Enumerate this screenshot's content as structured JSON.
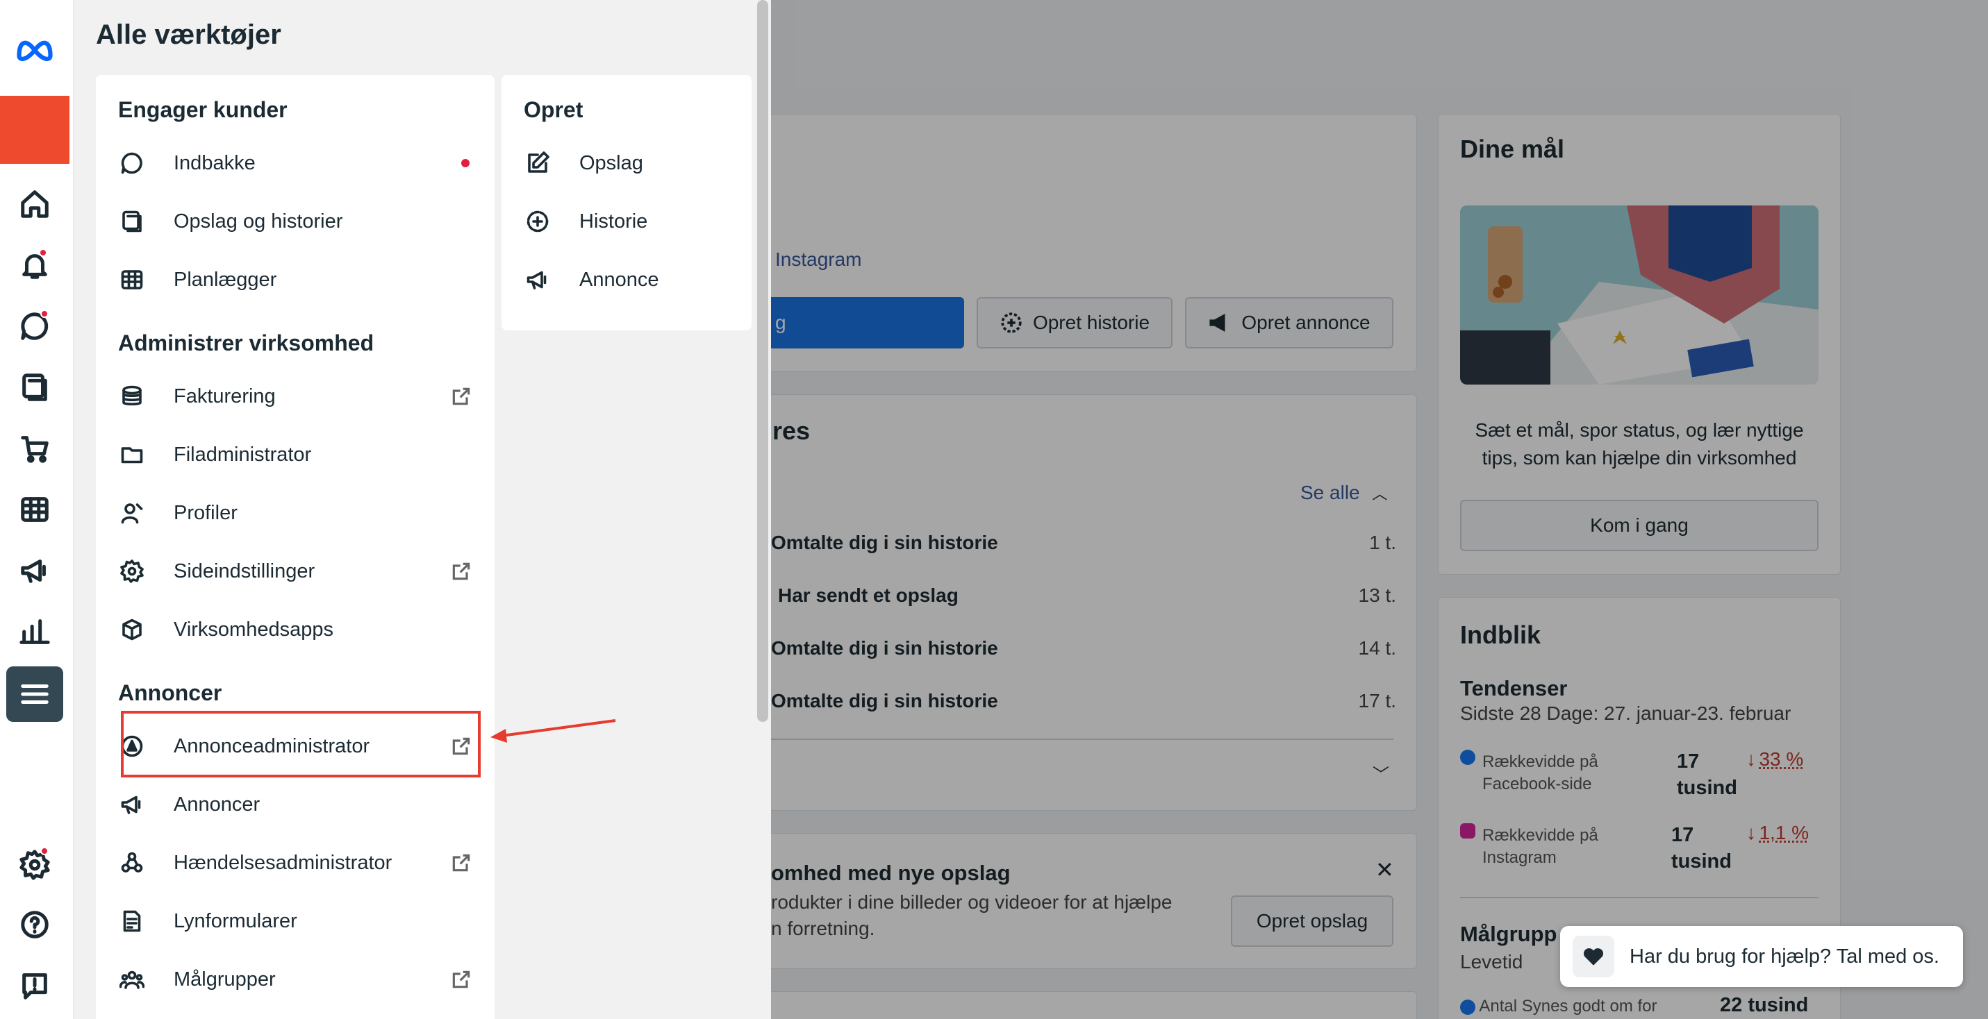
{
  "drawer": {
    "title": "Alle værktøjer",
    "engage": {
      "title": "Engager kunder",
      "items": [
        {
          "label": "Indbakke"
        },
        {
          "label": "Opslag og historier"
        },
        {
          "label": "Planlægger"
        }
      ]
    },
    "manage": {
      "title": "Administrer virksomhed",
      "items": [
        {
          "label": "Fakturering"
        },
        {
          "label": "Filadministrator"
        },
        {
          "label": "Profiler"
        },
        {
          "label": "Sideindstillinger"
        },
        {
          "label": "Virksomhedsapps"
        }
      ]
    },
    "ads": {
      "title": "Annoncer",
      "items": [
        {
          "label": "Annonceadministrator"
        },
        {
          "label": "Annoncer"
        },
        {
          "label": "Hændelsesadministrator"
        },
        {
          "label": "Lynformularer"
        },
        {
          "label": "Målgrupper"
        }
      ]
    },
    "create": {
      "title": "Opret",
      "items": [
        {
          "label": "Opslag"
        },
        {
          "label": "Historie"
        },
        {
          "label": "Annonce"
        }
      ]
    }
  },
  "background": {
    "instagram_link": "Instagram",
    "post_button_partial": "g",
    "story_button": "Opret historie",
    "ad_button": "Opret annonce",
    "activity_title_partial": "res",
    "see_all": "Se alle",
    "activity": [
      {
        "text": "Omtalte dig i sin historie",
        "time": "1 t."
      },
      {
        "text": "Har sendt et opslag",
        "time": "13 t."
      },
      {
        "text": "Omtalte dig i sin historie",
        "time": "14 t."
      },
      {
        "text": "Omtalte dig i sin historie",
        "time": "17 t."
      }
    ],
    "promo_title_partial": "omhed med nye opslag",
    "promo_line1": "rodukter i dine billeder og videoer for at hjælpe",
    "promo_line2": "n forretning.",
    "promo_button": "Opret opslag",
    "goals": {
      "title": "Dine mål",
      "description": "Sæt et mål, spor status, og lær nyttige tips, som kan hjælpe din virksomhed",
      "button": "Kom i gang"
    },
    "insights": {
      "title": "Indblik",
      "trends_title": "Tendenser",
      "period": "Sidste 28 Dage: 27. januar-23. februar",
      "metrics": [
        {
          "label_1": "Rækkevidde på",
          "label_2": "Facebook-side",
          "value_1": "17",
          "value_2": "tusind",
          "change": "33 %"
        },
        {
          "label_1": "Rækkevidde på",
          "label_2": "Instagram",
          "value_1": "17",
          "value_2": "tusind",
          "change": "1,1 %"
        }
      ],
      "audience_title": "Målgrupp",
      "audience_sub": "Levetid",
      "likes_label": "Antal Synes godt om for",
      "likes_value": "22 tusind"
    }
  },
  "help": {
    "text": "Har du brug for hjælp? Tal med os."
  },
  "colors": {
    "accent_red": "#e63b2e",
    "brand_blue": "#0064e0",
    "notification": "#e41e3f"
  }
}
